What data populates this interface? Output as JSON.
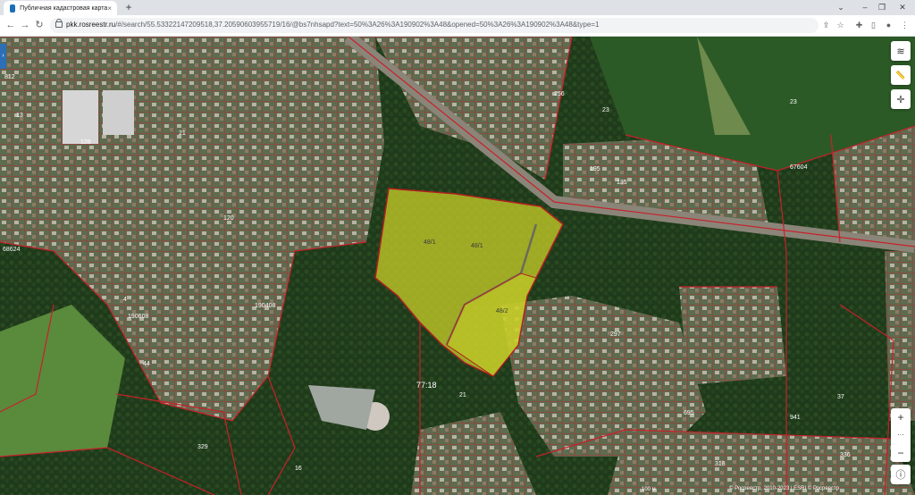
{
  "browser": {
    "tab_title": "Публичная кадастровая карта",
    "tab_close": "×",
    "new_tab": "+",
    "minimize": "–",
    "restore": "❐",
    "close": "✕",
    "url_domain": "pkk.rosreestr.ru",
    "url_path": "/#/search/55.53322147209518,37.20590603955719/16/@bs7nhsapd?text=50%3A26%3A190902%3A48&opened=50%3A26%3A190902%3A48&type=1",
    "back": "←",
    "forward": "→",
    "reload": "↻"
  },
  "map": {
    "parcels": {
      "p1": "48/1",
      "p2": "48/1",
      "p3": "48/2"
    },
    "quarter": "77:18",
    "labels": [
      "812",
      "13",
      "21",
      "23",
      "256",
      "23",
      "67604",
      "190608",
      "68624",
      "190408",
      "4",
      "195",
      "120",
      "135",
      "44",
      "21",
      "37",
      "941",
      "695",
      "297",
      "318",
      "336",
      "329",
      "128",
      "16",
      "77"
    ],
    "copyright": "© Росреестр, 2010-2023 | ESRI © Росреестр",
    "scale": "100 м",
    "panel_toggle": "›"
  },
  "controls": {
    "layers_icon": "≋",
    "ruler_icon": "📏",
    "locate_icon": "✛",
    "zoom_in": "+",
    "zoom_dots": "···",
    "zoom_out": "−",
    "info_icon": "ⓘ"
  },
  "colors": {
    "parcel_fill": "#c9cf28",
    "boundary": "#c8202a",
    "highlight_border": "#b02020"
  }
}
